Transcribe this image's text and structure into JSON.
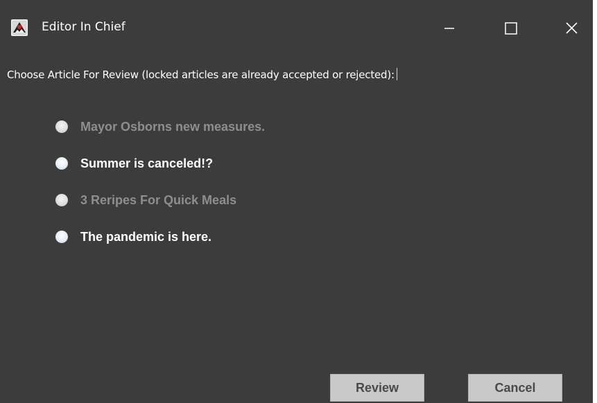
{
  "window": {
    "title": "Editor In Chief",
    "icon": "java-duke-icon",
    "controls": {
      "minimize": "minimize-icon",
      "maximize": "maximize-icon",
      "close": "close-icon"
    }
  },
  "prompt": "Choose Article For Review (locked articles are already accepted or rejected):",
  "articles": [
    {
      "label": "Mayor Osborns new measures.",
      "locked": true
    },
    {
      "label": "Summer is canceled!?",
      "locked": false
    },
    {
      "label": "3 Reripes For Quick Meals",
      "locked": true
    },
    {
      "label": "The pandemic is here.",
      "locked": false
    }
  ],
  "buttons": {
    "review": "Review",
    "cancel": "Cancel"
  },
  "colors": {
    "background": "#3c3c3c",
    "text_enabled": "#ffffff",
    "text_disabled": "#8e8e8e",
    "button_bg": "#c9c9c9",
    "button_text": "#4a4a4a"
  }
}
